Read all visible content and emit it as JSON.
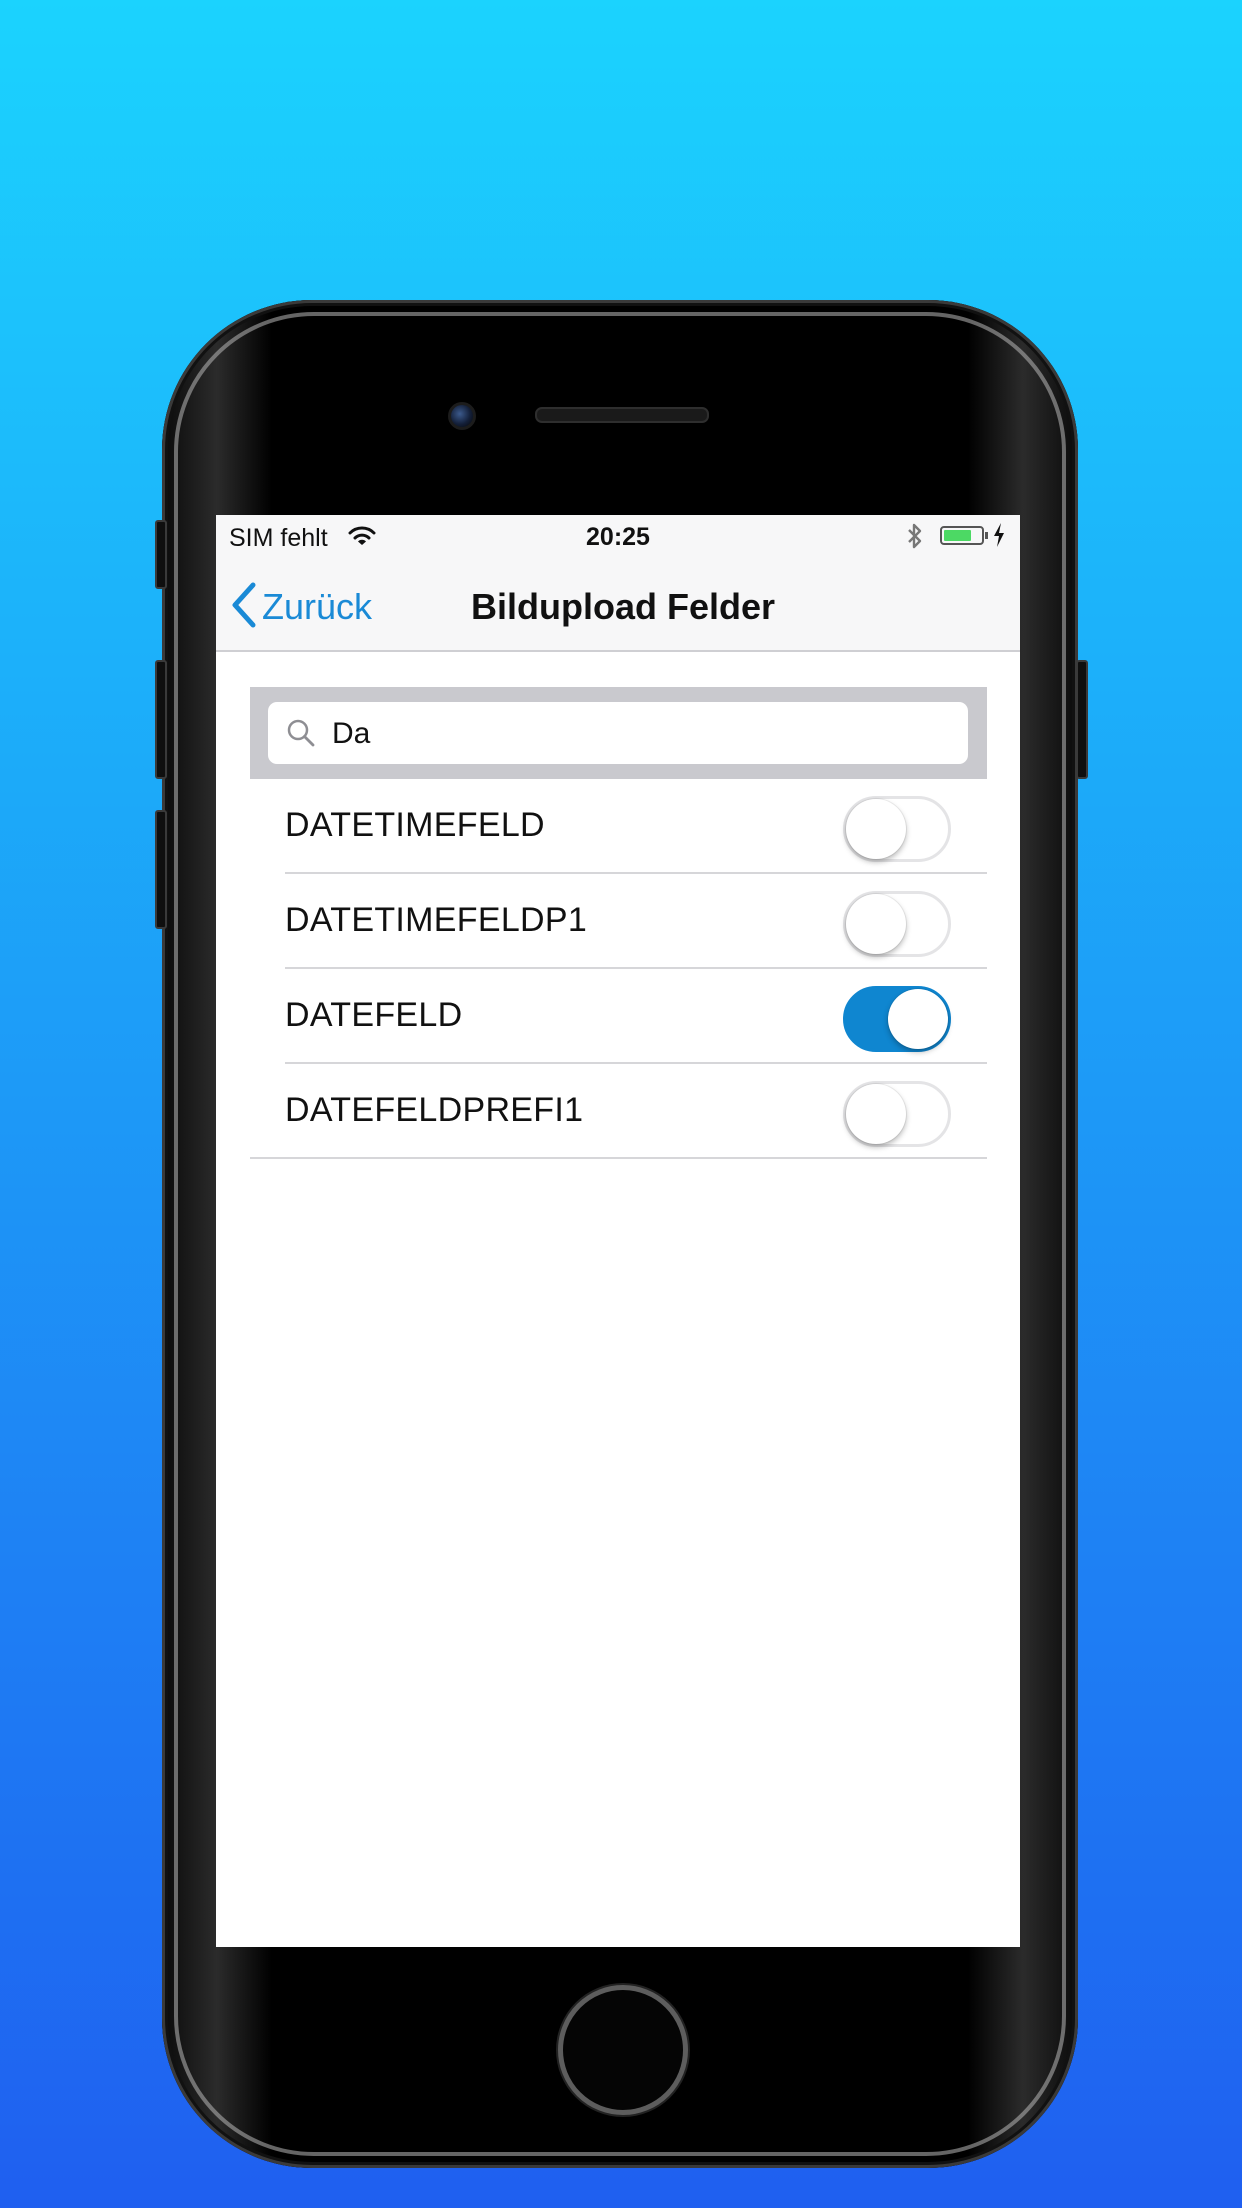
{
  "status_bar": {
    "carrier": "SIM fehlt",
    "time": "20:25",
    "battery_level": 0.75,
    "icons": [
      "wifi-icon",
      "bluetooth-icon",
      "battery-icon",
      "charging-icon"
    ]
  },
  "nav": {
    "back_label": "Zurück",
    "title": "Bildupload Felder"
  },
  "search": {
    "value": "Da",
    "icon": "search-icon"
  },
  "fields": [
    {
      "label": "DATETIMEFELD",
      "enabled": false
    },
    {
      "label": "DATETIMEFELDP1",
      "enabled": false
    },
    {
      "label": "DATEFELD",
      "enabled": true
    },
    {
      "label": "DATEFELDPREFI1",
      "enabled": false
    }
  ],
  "colors": {
    "accent": "#0f86d0",
    "back_tint": "#1a8ad6",
    "background_top": "#1bd3fe",
    "background_bottom": "#1f5ff0"
  }
}
